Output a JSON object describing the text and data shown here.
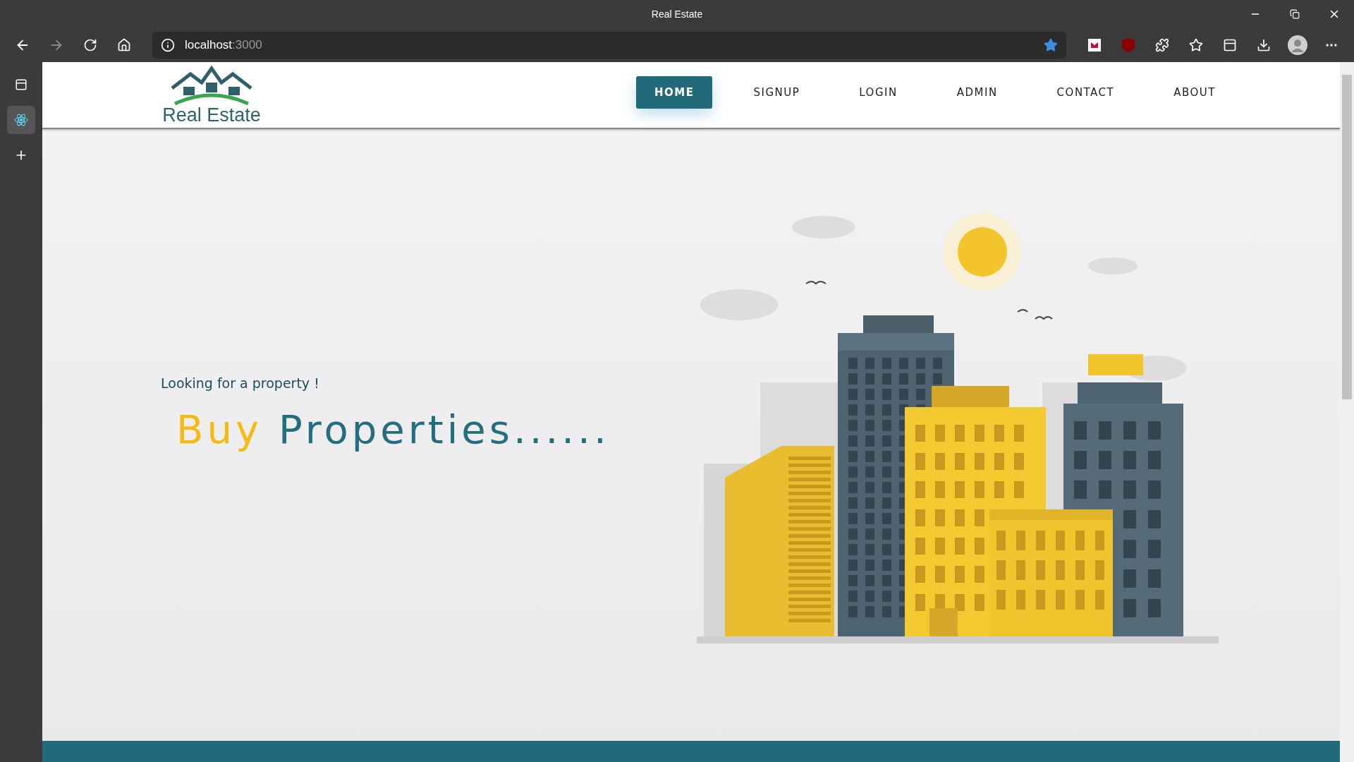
{
  "browser": {
    "tab_title": "Real Estate",
    "url_host": "localhost",
    "url_port": ":3000",
    "bookmarked": true
  },
  "navbar": {
    "logo_text": "Real Estate",
    "items": [
      {
        "label": "HOME",
        "selected": true
      },
      {
        "label": "SIGNUP",
        "selected": false
      },
      {
        "label": "LOGIN",
        "selected": false
      },
      {
        "label": "ADMIN",
        "selected": false
      },
      {
        "label": "CONTACT",
        "selected": false
      },
      {
        "label": "ABOUT",
        "selected": false
      }
    ]
  },
  "hero": {
    "subtitle": "Looking for a property !",
    "headline_accent": "Buy",
    "headline_rest": "Properties......"
  }
}
